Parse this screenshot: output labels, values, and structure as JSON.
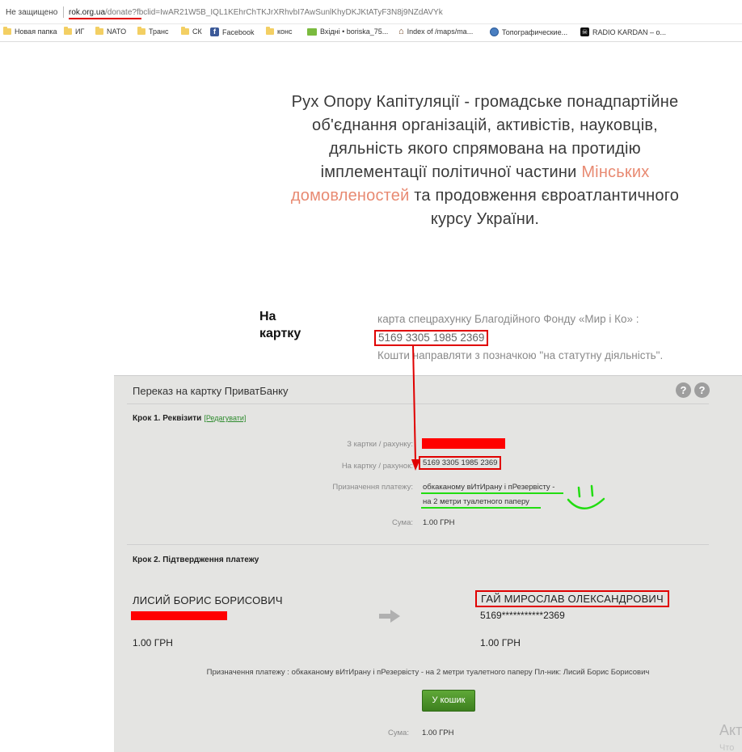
{
  "browser": {
    "insecure_label": "Не защищено",
    "url_host": "rok.org.ua",
    "url_path": "/donate?fbclid=IwAR21W5B_IQL1KEhrChTKJrXRhvbI7AwSunlKhyDKJKtATyF3N8j9NZdAVYk",
    "bookmarks": [
      {
        "label": "Новая папка",
        "icon": "folder-icon"
      },
      {
        "label": "ИГ",
        "icon": "folder-icon"
      },
      {
        "label": "NATO",
        "icon": "folder-icon"
      },
      {
        "label": "Транс",
        "icon": "folder-icon"
      },
      {
        "label": "СК",
        "icon": "folder-icon"
      },
      {
        "label": "Facebook",
        "icon": "facebook-icon"
      },
      {
        "label": "конс",
        "icon": "folder-icon"
      },
      {
        "label": "Вхідні • boriska_75...",
        "icon": "mail-icon"
      },
      {
        "label": "Index of /maps/ma...",
        "icon": "home-icon"
      },
      {
        "label": "Топографические...",
        "icon": "globe-icon"
      },
      {
        "label": "RADIO KARDAN – о...",
        "icon": "radio-icon"
      }
    ]
  },
  "hero": {
    "line1": "Рух Опору Капітуляції - громадське понадпартійне",
    "line2": "об'єднання організацій, активістів, науковців,",
    "line3": "дяльність якого спрямована на протидію",
    "line4_start": "імплементації політичної частини ",
    "link_part1": "Мінських",
    "link_part2": "домовленостей",
    "line5_end": " та продовження євроатлантичного",
    "line6": "курсу України."
  },
  "card_section": {
    "heading": "На картку",
    "account_label": "карта спецрахунку Благодійного Фонду «Мир і Ко» :",
    "card_number": "5169 3305 1985 2369",
    "note": "Кошти направляти з позначкою \"на статутну діяльність\"."
  },
  "privat": {
    "title": "Переказ на картку ПриватБанку",
    "step1": {
      "title": "Крок 1. Реквізити",
      "edit": "[Редагувати]",
      "from_label": "З картки / рахунку:",
      "to_label": "На картку / рахунок:",
      "to_value": "5169 3305 1985 2369",
      "purpose_label": "Призначення платежу:",
      "purpose_line1": "обкаканому вИтИрану і пРезервісту -",
      "purpose_line2": "на 2 метри туалетного паперу",
      "sum_label": "Сума:",
      "sum_value": "1.00 ГРН"
    },
    "step2": {
      "title": "Крок 2. Підтвердження платежу",
      "sender_name": "ЛИСИЙ БОРИС БОРИСОВИЧ",
      "sender_amount": "1.00 ГРН",
      "recipient_name": "ГАЙ МИРОСЛАВ ОЛЕКСАНДРОВИЧ",
      "recipient_card": "5169***********2369",
      "recipient_amount": "1.00 ГРН",
      "summary": "Призначення платежу : обкаканому вИтИрану і пРезервісту - на 2 метри туалетного паперу Пл-ник: Лисий Борис Борисович",
      "cart_button": "У кошик",
      "sum_label": "Сума:",
      "sum_value": "1.00 ГРН"
    }
  },
  "watermark": {
    "line1": "Акт",
    "line2": "Что"
  },
  "colors": {
    "annotation_red": "#e00000",
    "annotation_green": "#22dd11",
    "link_salmon": "#e88a72",
    "panel_gray": "#e4e4e2",
    "button_green": "#4a8f28"
  }
}
